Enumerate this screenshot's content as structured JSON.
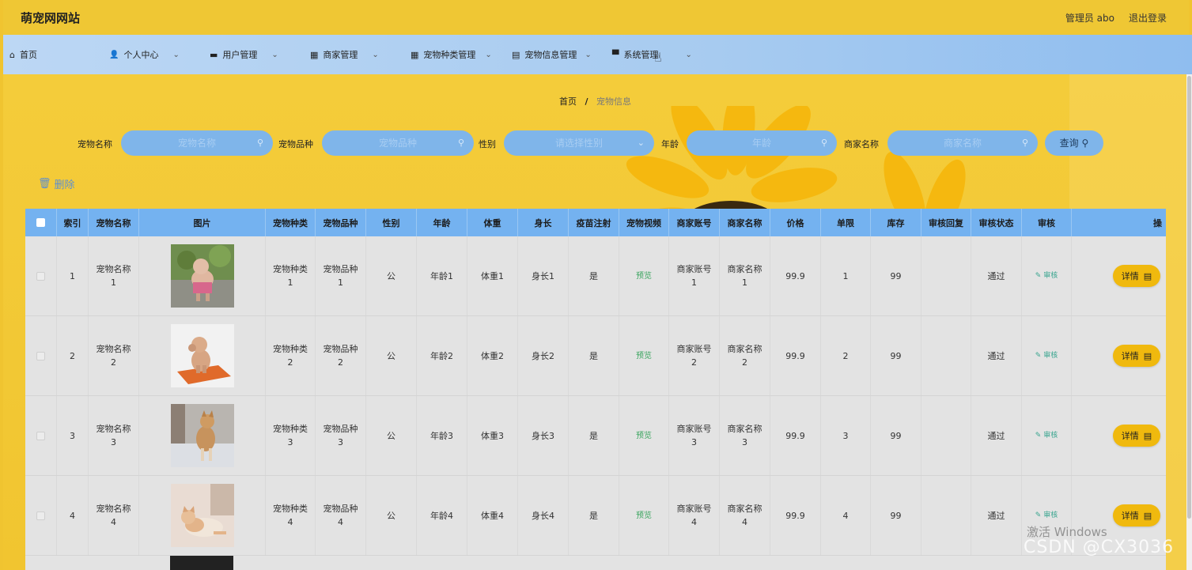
{
  "header": {
    "site_title": "萌宠网网站",
    "admin_label": "管理员 abo",
    "logout_label": "退出登录"
  },
  "nav": {
    "items": [
      {
        "label": "首页",
        "icon": "home-icon",
        "glyph": "⌂",
        "has_dropdown": false
      },
      {
        "label": "个人中心",
        "icon": "user-icon",
        "glyph": "👤",
        "has_dropdown": true
      },
      {
        "label": "用户管理",
        "icon": "briefcase-icon",
        "glyph": "▬",
        "has_dropdown": true
      },
      {
        "label": "商家管理",
        "icon": "grid-icon",
        "glyph": "▦",
        "has_dropdown": true
      },
      {
        "label": "宠物种类管理",
        "icon": "grid-icon",
        "glyph": "▦",
        "has_dropdown": true
      },
      {
        "label": "宠物信息管理",
        "icon": "clipboard-icon",
        "glyph": "▤",
        "has_dropdown": true
      },
      {
        "label": "系统管理",
        "icon": "monitor-icon",
        "glyph": "▀",
        "has_dropdown": true
      }
    ]
  },
  "breadcrumb": {
    "home": "首页",
    "separator": "/",
    "current": "宠物信息"
  },
  "search": {
    "fields": [
      {
        "label": "宠物名称",
        "placeholder": "宠物名称",
        "icon": "search-icon"
      },
      {
        "label": "宠物品种",
        "placeholder": "宠物品种",
        "icon": "search-icon"
      },
      {
        "label": "性别",
        "placeholder": "请选择性别",
        "icon": "chevron-down-icon"
      },
      {
        "label": "年龄",
        "placeholder": "年龄",
        "icon": "search-icon"
      },
      {
        "label": "商家名称",
        "placeholder": "商家名称",
        "icon": "search-icon"
      }
    ],
    "query_label": "查询"
  },
  "actions": {
    "delete_label": "删除"
  },
  "table": {
    "columns": [
      "",
      "索引",
      "宠物名称",
      "图片",
      "宠物种类",
      "宠物品种",
      "性别",
      "年龄",
      "体重",
      "身长",
      "疫苗注射",
      "宠物视频",
      "商家账号",
      "商家名称",
      "价格",
      "单限",
      "库存",
      "审核回复",
      "审核状态",
      "审核",
      "操"
    ],
    "preview_label": "预览",
    "audit_label": "审核",
    "detail_label": "详情",
    "rows": [
      {
        "index": "1",
        "name": [
          "宠物名称",
          "1"
        ],
        "kind": [
          "宠物种类",
          "1"
        ],
        "breed": [
          "宠物品种",
          "1"
        ],
        "gender": "公",
        "age": "年龄1",
        "weight": "体重1",
        "length": "身长1",
        "vaccine": "是",
        "merchant_account": [
          "商家账号",
          "1"
        ],
        "merchant_name": [
          "商家名称",
          "1"
        ],
        "price": "99.9",
        "limit": "1",
        "stock": "99",
        "reply": "",
        "status": "通过",
        "photo": "poodle-photo"
      },
      {
        "index": "2",
        "name": [
          "宠物名称",
          "2"
        ],
        "kind": [
          "宠物种类",
          "2"
        ],
        "breed": [
          "宠物品种",
          "2"
        ],
        "gender": "公",
        "age": "年龄2",
        "weight": "体重2",
        "length": "身长2",
        "vaccine": "是",
        "merchant_account": [
          "商家账号",
          "2"
        ],
        "merchant_name": [
          "商家名称",
          "2"
        ],
        "price": "99.9",
        "limit": "2",
        "stock": "99",
        "reply": "",
        "status": "通过",
        "photo": "poodle-cushion-photo"
      },
      {
        "index": "3",
        "name": [
          "宠物名称",
          "3"
        ],
        "kind": [
          "宠物种类",
          "3"
        ],
        "breed": [
          "宠物品种",
          "3"
        ],
        "gender": "公",
        "age": "年龄3",
        "weight": "体重3",
        "length": "身长3",
        "vaccine": "是",
        "merchant_account": [
          "商家账号",
          "3"
        ],
        "merchant_name": [
          "商家名称",
          "3"
        ],
        "price": "99.9",
        "limit": "3",
        "stock": "99",
        "reply": "",
        "status": "通过",
        "photo": "shiba-photo"
      },
      {
        "index": "4",
        "name": [
          "宠物名称",
          "4"
        ],
        "kind": [
          "宠物种类",
          "4"
        ],
        "breed": [
          "宠物品种",
          "4"
        ],
        "gender": "公",
        "age": "年龄4",
        "weight": "体重4",
        "length": "身长4",
        "vaccine": "是",
        "merchant_account": [
          "商家账号",
          "4"
        ],
        "merchant_name": [
          "商家名称",
          "4"
        ],
        "price": "99.9",
        "limit": "4",
        "stock": "99",
        "reply": "",
        "status": "通过",
        "photo": "cat-photo"
      }
    ]
  },
  "watermark": {
    "line1": "激活 Windows",
    "line2": "CSDN @CX3036"
  },
  "colors": {
    "header_yellow": "#efc734",
    "nav_blue": "#a7cbf0",
    "table_head_blue": "#74b2f0",
    "detail_btn": "#f0b90e",
    "preview_green": "#3aa55f"
  }
}
